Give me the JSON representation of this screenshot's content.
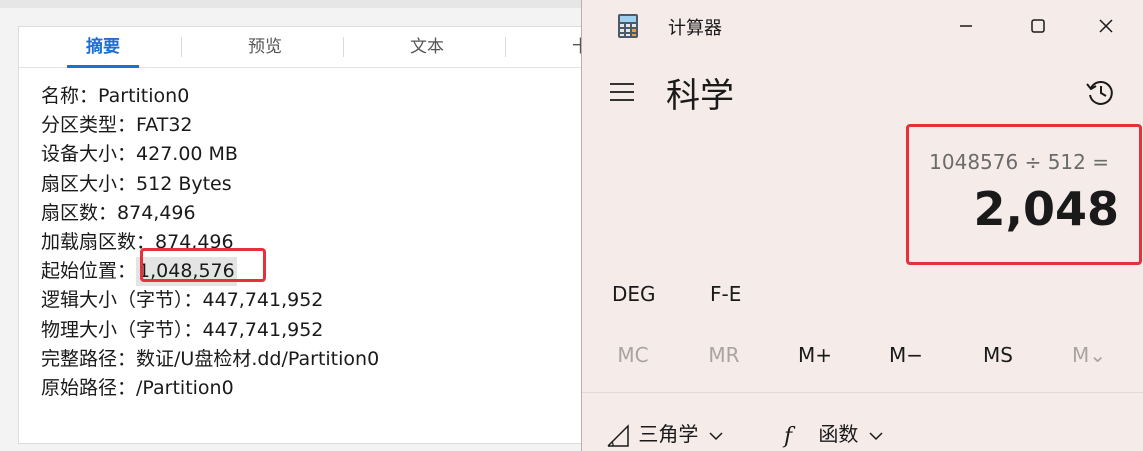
{
  "summary": {
    "tabs": [
      "摘要",
      "预览",
      "文本",
      "十六"
    ],
    "rows": [
      {
        "label": "名称：",
        "value": "Partition0"
      },
      {
        "label": "分区类型：",
        "value": "FAT32"
      },
      {
        "label": "设备大小：",
        "value": "427.00 MB"
      },
      {
        "label": "扇区大小：",
        "value": "512 Bytes"
      },
      {
        "label": "扇区数：",
        "value": "874,496"
      },
      {
        "label": "加载扇区数：",
        "value": "874,496"
      },
      {
        "label": "起始位置：",
        "value": "1,048,576"
      },
      {
        "label": "逻辑大小（字节）：",
        "value": "447,741,952"
      },
      {
        "label": "物理大小（字节）：",
        "value": "447,741,952"
      },
      {
        "label": "完整路径：",
        "value": "数证/U盘检材.dd/Partition0"
      },
      {
        "label": "原始路径：",
        "value": "/Partition0"
      }
    ]
  },
  "calculator": {
    "window_title": "计算器",
    "mode_title": "科学",
    "expression": "1048576 ÷ 512 =",
    "result": "2,048",
    "angle_unit": "DEG",
    "fe_label": "F-E",
    "memory": [
      "MC",
      "MR",
      "M+",
      "M−",
      "MS",
      "M⌄"
    ],
    "trig_label": "三角学",
    "func_label": "函数",
    "icons": [
      "calculator-icon",
      "minimize-icon",
      "maximize-icon",
      "close-icon",
      "menu-icon",
      "history-icon",
      "triangle-icon",
      "function-icon",
      "chevron-down-icon"
    ]
  },
  "colors": {
    "accent": "#1f6fd1",
    "highlight_box": "#e8303a",
    "calc_background": "#f5ecea"
  }
}
